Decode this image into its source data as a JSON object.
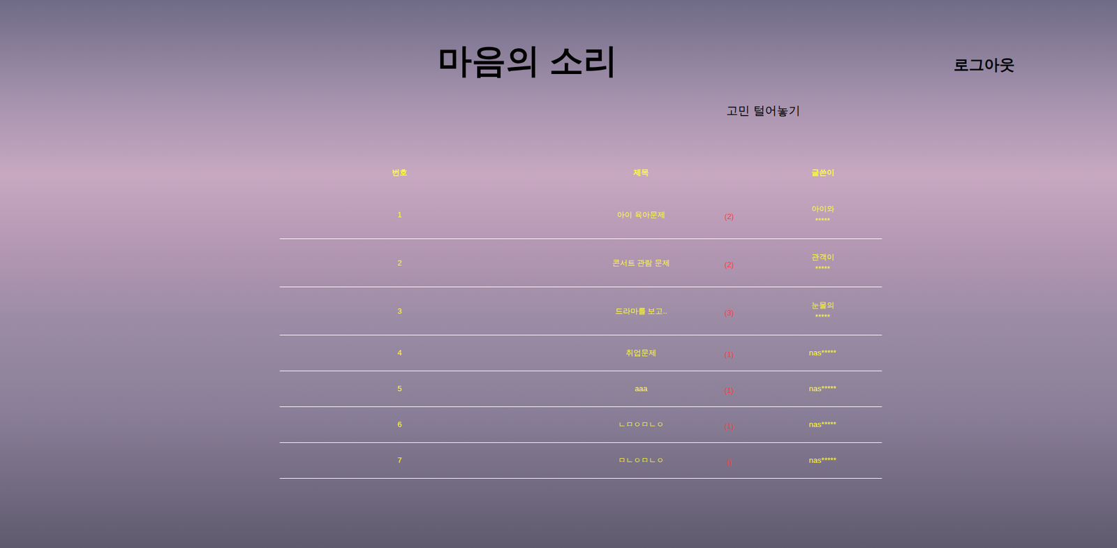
{
  "header": {
    "title": "마음의 소리",
    "logout": "로그아웃"
  },
  "write_link": "고민 털어놓기",
  "table": {
    "columns": [
      "번호",
      "제목",
      "글쓴이"
    ],
    "rows": [
      {
        "number": "1",
        "title": "아이 육아문제",
        "count": "(2)",
        "writer": [
          "아이와",
          "*****"
        ]
      },
      {
        "number": "2",
        "title": "콘서트 관람 문제",
        "count": "(2)",
        "writer": [
          "관객이",
          "*****"
        ]
      },
      {
        "number": "3",
        "title": "드라마를 보고..",
        "count": "(3)",
        "writer": [
          "눈물의",
          "*****"
        ]
      },
      {
        "number": "4",
        "title": "취업문제",
        "count": "(1)",
        "writer": [
          "nas*****"
        ]
      },
      {
        "number": "5",
        "title": "aaa",
        "count": "(1)",
        "writer": [
          "nas*****"
        ]
      },
      {
        "number": "6",
        "title": "ㄴㅁㅇㅁㄴㅇ",
        "count": "(1)",
        "writer": [
          "nas*****"
        ]
      },
      {
        "number": "7",
        "title": "ㅁㄴㅇㅁㄴㅇ",
        "count": "()",
        "writer": [
          "nas*****"
        ]
      }
    ]
  }
}
